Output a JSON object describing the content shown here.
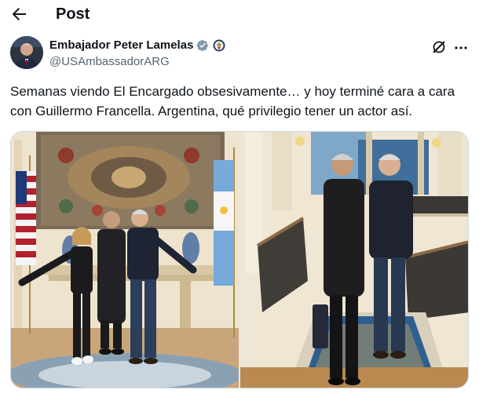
{
  "header": {
    "title": "Post",
    "back_icon": "arrow-left-icon"
  },
  "author": {
    "name": "Embajador Peter Lamelas",
    "handle": "@USAmbassadorARG",
    "verified_icon": "verified-badge-icon",
    "affiliation_icon": "us-seal-icon",
    "verified_color": "#829aab"
  },
  "actions": {
    "grok_icon": "grok-icon",
    "more_icon": "more-icon"
  },
  "tweet": {
    "text": "Semanas viendo El Encargado obsesivamente… y hoy terminé cara a cara con Guillermo Francella. Argentina, qué privilegio tener un actor así."
  },
  "media": {
    "count": 2
  },
  "colors": {
    "text": "#0f1419",
    "secondary_text": "#536471",
    "border": "#cfd9de"
  }
}
